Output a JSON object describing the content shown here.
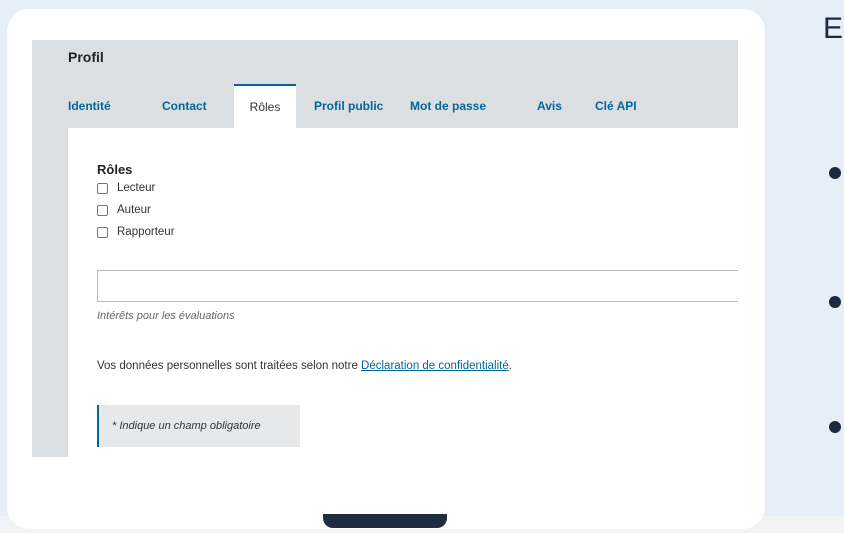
{
  "page_title": "Profil",
  "tabs": [
    {
      "label": "Identité"
    },
    {
      "label": "Contact"
    },
    {
      "label": "Rôles"
    },
    {
      "label": "Profil public"
    },
    {
      "label": "Mot de passe"
    },
    {
      "label": "Avis"
    },
    {
      "label": "Clé API"
    }
  ],
  "active_tab": "Rôles",
  "roles": {
    "heading": "Rôles",
    "options": [
      {
        "label": "Lecteur",
        "checked": false
      },
      {
        "label": "Auteur",
        "checked": false
      },
      {
        "label": "Rapporteur",
        "checked": false
      }
    ]
  },
  "interests": {
    "value": "",
    "label": "Intérêts pour les évaluations"
  },
  "privacy": {
    "text": "Vos données personnelles sont traitées selon notre ",
    "link": "Déclaration de confidentialité",
    "suffix": "."
  },
  "required_note": "* Indique un champ obligatoire",
  "side_panel": {
    "partial_letter": "E",
    "bullets": 3
  },
  "colors": {
    "accent": "#006798",
    "background": "#e6eef7",
    "laptop_dark": "#1f2c42"
  }
}
